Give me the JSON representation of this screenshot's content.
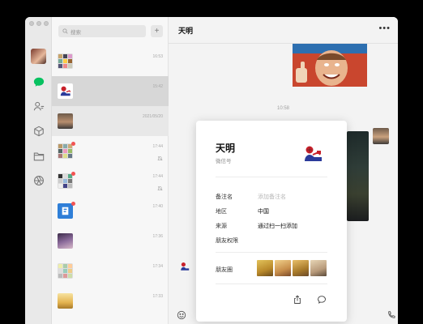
{
  "app": {
    "name": "WeChat",
    "accent": "#07c160"
  },
  "search": {
    "placeholder": "搜索"
  },
  "add_button": {
    "label": "+"
  },
  "chat_list": [
    {
      "time": "16:53",
      "muted": false,
      "unread": false,
      "avatar": "group-grid"
    },
    {
      "time": "15:42",
      "muted": false,
      "unread": false,
      "avatar": "spiderman",
      "selected": true
    },
    {
      "time": "2021/05/20",
      "muted": false,
      "unread": false,
      "avatar": "portrait",
      "highlight": true
    },
    {
      "time": "17:44",
      "muted": true,
      "unread": true,
      "avatar": "group-grid"
    },
    {
      "time": "17:44",
      "muted": true,
      "unread": true,
      "avatar": "group-grid"
    },
    {
      "time": "17:40",
      "muted": false,
      "unread": true,
      "avatar": "app-blue"
    },
    {
      "time": "17:36",
      "muted": false,
      "unread": false,
      "avatar": "photo-purple"
    },
    {
      "time": "17:34",
      "muted": false,
      "unread": false,
      "avatar": "group-grid"
    },
    {
      "time": "17:33",
      "muted": false,
      "unread": false,
      "avatar": "food"
    }
  ],
  "conversation": {
    "title": "天明",
    "time_separator": "10:58"
  },
  "profile_card": {
    "name": "天明",
    "wechat_id_label": "微信号",
    "fields": [
      {
        "label": "备注名",
        "value": "添加备注名",
        "placeholder": true
      },
      {
        "label": "地区",
        "value": "中国",
        "placeholder": false
      },
      {
        "label": "来源",
        "value": "通过扫一扫添加",
        "placeholder": false
      },
      {
        "label": "朋友权限",
        "value": "",
        "placeholder": false
      }
    ],
    "moments_label": "朋友圈",
    "actions": [
      "share-icon",
      "message-icon"
    ]
  },
  "icons": {
    "rail": [
      "chat-icon",
      "contacts-icon",
      "cube-icon",
      "folder-icon",
      "aperture-icon"
    ],
    "composer": [
      "emoji-icon",
      "phone-icon",
      "video-icon"
    ]
  }
}
